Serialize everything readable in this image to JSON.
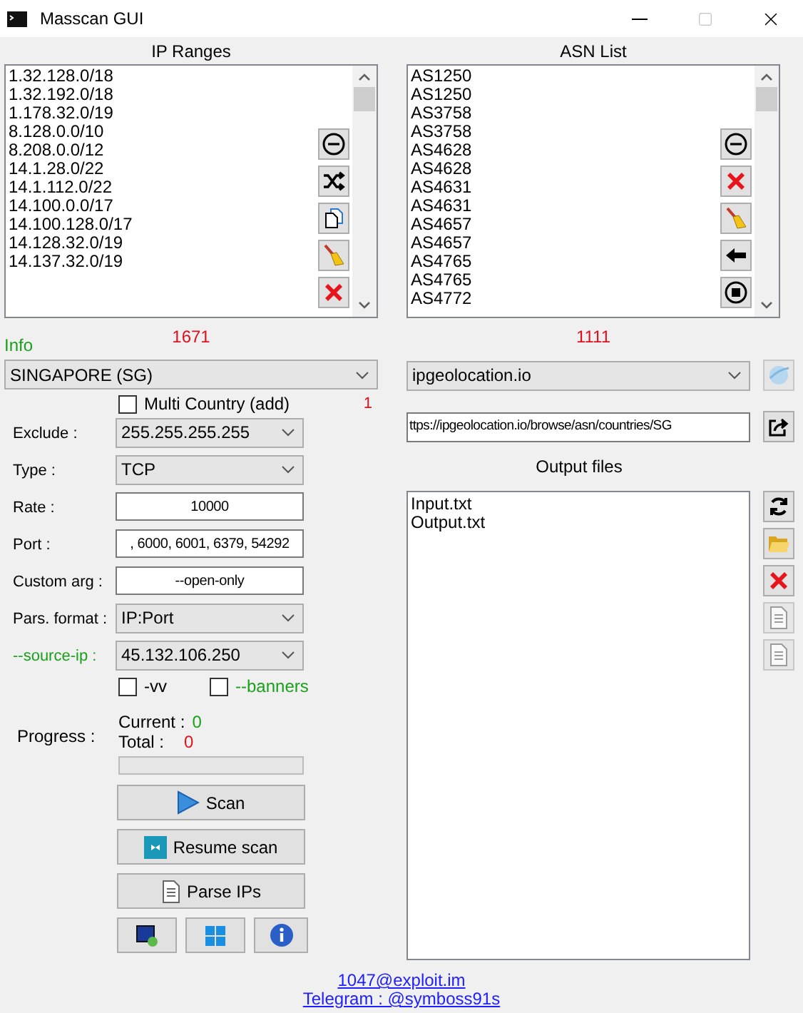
{
  "window": {
    "title": "Masscan GUI"
  },
  "ip_ranges": {
    "heading": "IP Ranges",
    "items": [
      "1.32.128.0/18",
      "1.32.192.0/18",
      "1.178.32.0/19",
      "8.128.0.0/10",
      "8.208.0.0/12",
      "14.1.28.0/22",
      "14.1.112.0/22",
      "14.100.0.0/17",
      "14.100.128.0/17",
      "14.128.32.0/19",
      "14.137.32.0/19"
    ],
    "count": "1671"
  },
  "asn_list": {
    "heading": "ASN List",
    "items": [
      "AS1250",
      "AS1250",
      "AS3758",
      "AS3758",
      "AS4628",
      "AS4628",
      "AS4631",
      "AS4631",
      "AS4657",
      "AS4657",
      "AS4765",
      "AS4765",
      "AS4772"
    ],
    "count": "1111"
  },
  "info_label": "Info",
  "country_select": {
    "value": "SINGAPORE (SG)"
  },
  "multi_country": {
    "label": "Multi Country (add)",
    "checked": false
  },
  "multi_country_count": "1",
  "form": [
    {
      "label": "Exclude :",
      "kind": "select",
      "value": "255.255.255.255",
      "highlighted": false
    },
    {
      "label": "Type :",
      "kind": "select",
      "value": "TCP",
      "highlighted": false
    },
    {
      "label": "Rate :",
      "kind": "input",
      "value": "10000",
      "highlighted": false
    },
    {
      "label": "Port :",
      "kind": "input",
      "value": ", 6000, 6001, 6379, 54292",
      "highlighted": false
    },
    {
      "label": "Custom arg :",
      "kind": "input",
      "value": "--open-only",
      "highlighted": false
    },
    {
      "label": "Pars. format :",
      "kind": "select",
      "value": "IP:Port",
      "highlighted": false
    },
    {
      "label": "--source-ip :",
      "kind": "select",
      "value": "45.132.106.250",
      "highlighted": true
    }
  ],
  "options": [
    {
      "label": "-vv",
      "checked": false,
      "highlighted": false
    },
    {
      "label": "--banners",
      "checked": false,
      "highlighted": true
    }
  ],
  "progress": {
    "label": "Progress :",
    "current_label": "Current :",
    "current": "0",
    "total_label": "Total :",
    "total": "0",
    "level": 0
  },
  "actions": [
    {
      "kind": "scan",
      "label": "Scan"
    },
    {
      "kind": "resume",
      "label": "Resume scan"
    },
    {
      "kind": "parse",
      "label": "Parse IPs"
    }
  ],
  "source_select": {
    "value": "ipgeolocation.io"
  },
  "url_field": {
    "value": "ttps://ipgeolocation.io/browse/asn/countries/SG"
  },
  "output_files": {
    "heading": "Output files",
    "items": [
      "Input.txt",
      "Output.txt"
    ]
  },
  "links": [
    "1047@exploit.im",
    "Telegram : @symboss91s"
  ]
}
